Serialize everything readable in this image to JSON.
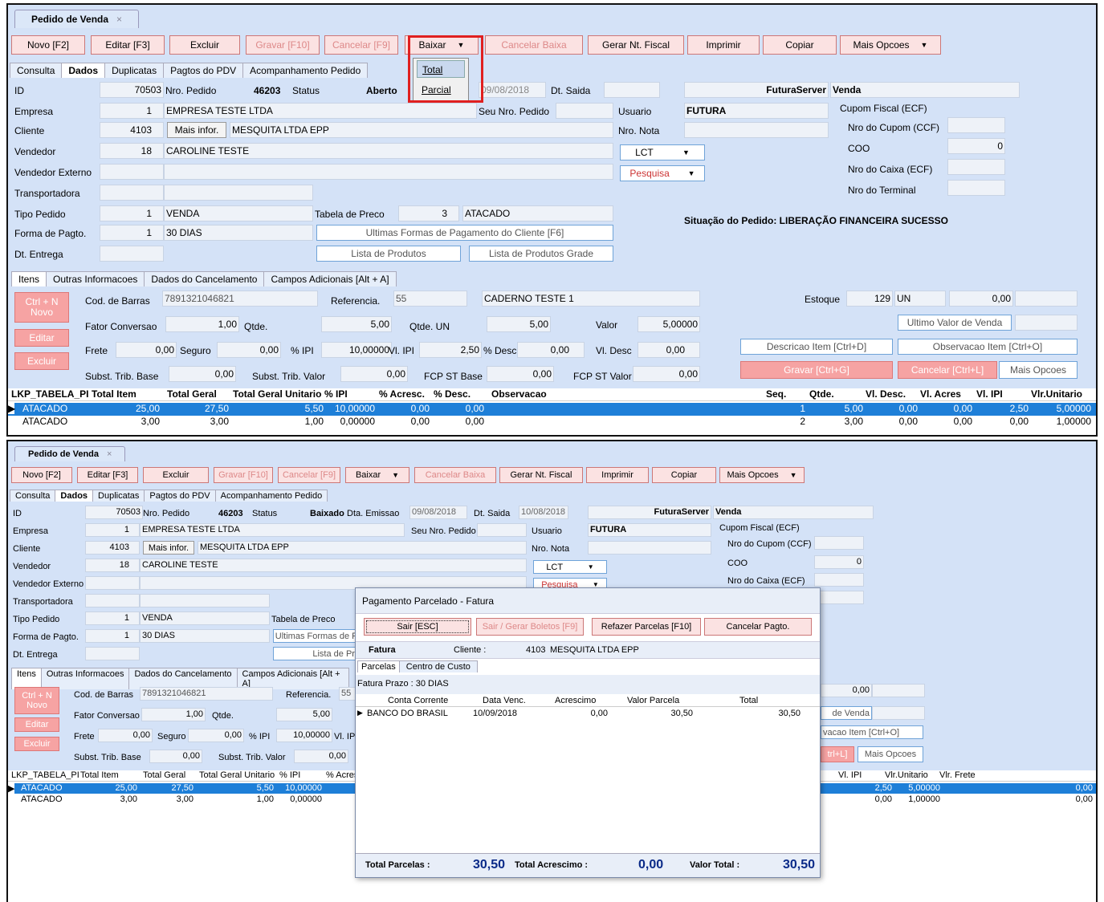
{
  "window": {
    "tab": "Pedido de Venda",
    "close": "×"
  },
  "toolbar": {
    "novo": "Novo [F2]",
    "editar": "Editar [F3]",
    "excluir": "Excluir",
    "gravar": "Gravar [F10]",
    "cancelar": "Cancelar [F9]",
    "baixar": "Baixar",
    "cancelar_baixa": "Cancelar Baixa",
    "gerar_nf": "Gerar Nt. Fiscal",
    "imprimir": "Imprimir",
    "copiar": "Copiar",
    "mais": "Mais Opcoes"
  },
  "baixar_menu": {
    "total": "Total",
    "parcial": "Parcial"
  },
  "tabs": [
    "Consulta",
    "Dados",
    "Duplicatas",
    "Pagtos do PDV",
    "Acompanhamento Pedido"
  ],
  "form": {
    "id_label": "ID",
    "id": "70503",
    "nro_pedido_label": "Nro. Pedido",
    "nro_pedido": "46203",
    "status_label": "Status",
    "status1": "Aberto",
    "status2": "Baixado",
    "dta_emissao_label": "Dta. Emissao",
    "dta_emissao": "09/08/2018",
    "dt_saida_label": "Dt. Saida",
    "dt_saida2": "10/08/2018",
    "server": "FuturaServer",
    "venda": "Venda",
    "empresa_label": "Empresa",
    "empresa_cod": "1",
    "empresa": "EMPRESA TESTE LTDA",
    "seu_nro_label": "Seu Nro. Pedido",
    "usuario_label": "Usuario",
    "usuario": "FUTURA",
    "cliente_label": "Cliente",
    "cliente_cod": "4103",
    "mais_infor": "Mais infor.",
    "cliente": "MESQUITA LTDA EPP",
    "nro_nota_label": "Nro. Nota",
    "vendedor_label": "Vendedor",
    "vendedor_cod": "18",
    "vendedor": "CAROLINE TESTE",
    "lct": "LCT",
    "pesquisa": "Pesquisa",
    "vend_ext_label": "Vendedor Externo",
    "transp_label": "Transportadora",
    "tipo_label": "Tipo Pedido",
    "tipo_cod": "1",
    "tipo": "VENDA",
    "tabela_label": "Tabela de Preco",
    "tabela_cod": "3",
    "tabela": "ATACADO",
    "forma_label": "Forma de Pagto.",
    "forma_cod": "1",
    "forma": "30 DIAS",
    "ultimas": "Ultimas Formas de Pagamento do Cliente [F6]",
    "dt_entrega_label": "Dt. Entrega",
    "lista_prod": "Lista de Produtos",
    "lista_grade": "Lista de Produtos Grade",
    "cupom_label": "Cupom Fiscal (ECF)",
    "nro_cupom_label": "Nro do Cupom (CCF)",
    "coo_label": "COO",
    "coo": "0",
    "nro_caixa_label": "Nro do Caixa (ECF)",
    "nro_terminal_label": "Nro do Terminal",
    "situacao": "Situação do Pedido: LIBERAÇÃO FINANCEIRA SUCESSO"
  },
  "subtabs": [
    "Itens",
    "Outras Informacoes",
    "Dados do Cancelamento",
    "Campos Adicionais [Alt + A]"
  ],
  "item": {
    "novo": "Ctrl + N\nNovo",
    "editar": "Editar",
    "excluir": "Excluir",
    "cod_barras_label": "Cod. de Barras",
    "cod_barras": "7891321046821",
    "referencia_label": "Referencia.",
    "referencia": "55",
    "produto": "CADERNO TESTE 1",
    "estoque_label": "Estoque",
    "estoque": "129",
    "un": "UN",
    "estoque_val": "0,00",
    "fator_label": "Fator Conversao",
    "fator": "1,00",
    "qtde_label": "Qtde.",
    "qtde": "5,00",
    "qtde_un_label": "Qtde. UN",
    "qtde_un": "5,00",
    "valor_label": "Valor",
    "valor": "5,00000",
    "ultimo_valor": "Ultimo Valor de Venda",
    "frete_label": "Frete",
    "frete": "0,00",
    "seguro_label": "Seguro",
    "seguro": "0,00",
    "ipi_label": "% IPI",
    "ipi": "10,00000",
    "vl_ipi_label": "Vl. IPI",
    "vl_ipi": "2,50",
    "desc_label": "% Desc",
    "desc": "0,00",
    "vl_desc_label": "Vl. Desc",
    "vl_desc": "0,00",
    "descricao_item": "Descricao Item [Ctrl+D]",
    "observacao_item": "Observacao Item [Ctrl+O]",
    "subst_base_label": "Subst. Trib. Base",
    "subst_base": "0,00",
    "subst_valor_label": "Subst. Trib. Valor",
    "subst_valor": "0,00",
    "fcp_base_label": "FCP ST Base",
    "fcp_base": "0,00",
    "fcp_valor_label": "FCP ST Valor",
    "fcp_valor": "0,00",
    "gravar": "Gravar [Ctrl+G]",
    "cancelar": "Cancelar [Ctrl+L]",
    "mais": "Mais Opcoes"
  },
  "grid": {
    "headers": [
      "LKP_TABELA_PI",
      "Total Item",
      "Total Geral",
      "Total Geral Unitario",
      "% IPI",
      "% Acresc.",
      "% Desc.",
      "Observacao",
      "Seq.",
      "Qtde.",
      "Vl. Desc.",
      "Vl. Acres",
      "Vl. IPI",
      "Vlr.Unitario",
      "Vlr. Frete"
    ],
    "rows": [
      {
        "tabela": "ATACADO",
        "total_item": "25,00",
        "total_geral": "27,50",
        "unit": "5,50",
        "ipi": "10,00000",
        "acresc": "0,00",
        "desc": "0,00",
        "seq": "1",
        "qtde": "5,00",
        "vl_desc": "0,00",
        "vl_acres": "0,00",
        "vl_ipi": "2,50",
        "vlr_unit": "5,00000",
        "frete": "0,00"
      },
      {
        "tabela": "ATACADO",
        "total_item": "3,00",
        "total_geral": "3,00",
        "unit": "1,00",
        "ipi": "0,00000",
        "acresc": "0,00",
        "desc": "0,00",
        "seq": "2",
        "qtde": "3,00",
        "vl_desc": "0,00",
        "vl_acres": "0,00",
        "vl_ipi": "0,00",
        "vlr_unit": "1,00000",
        "frete": "0,00"
      }
    ]
  },
  "dialog": {
    "title": "Pagamento Parcelado - Fatura",
    "sair": "Sair [ESC]",
    "sair_boletos": "Sair / Gerar Boletos [F9]",
    "refazer": "Refazer Parcelas [F10]",
    "cancelar_pagto": "Cancelar Pagto.",
    "fatura_label": "Fatura",
    "cliente_label": "Cliente :",
    "cliente_cod": "4103",
    "cliente": "MESQUITA LTDA EPP",
    "tabs": [
      "Parcelas",
      "Centro de Custo"
    ],
    "prazo": "Fatura Prazo : 30 DIAS",
    "headers": [
      "Conta Corrente",
      "Data Venc.",
      "Acrescimo",
      "Valor Parcela",
      "Total"
    ],
    "row": {
      "conta": "BANCO DO BRASIL",
      "data": "10/09/2018",
      "acrescimo": "0,00",
      "valor": "30,50",
      "total": "30,50"
    },
    "total_parcelas_label": "Total Parcelas :",
    "total_parcelas": "30,50",
    "total_acrescimo_label": "Total Acrescimo :",
    "total_acrescimo": "0,00",
    "valor_total_label": "Valor Total :",
    "valor_total": "30,50"
  }
}
